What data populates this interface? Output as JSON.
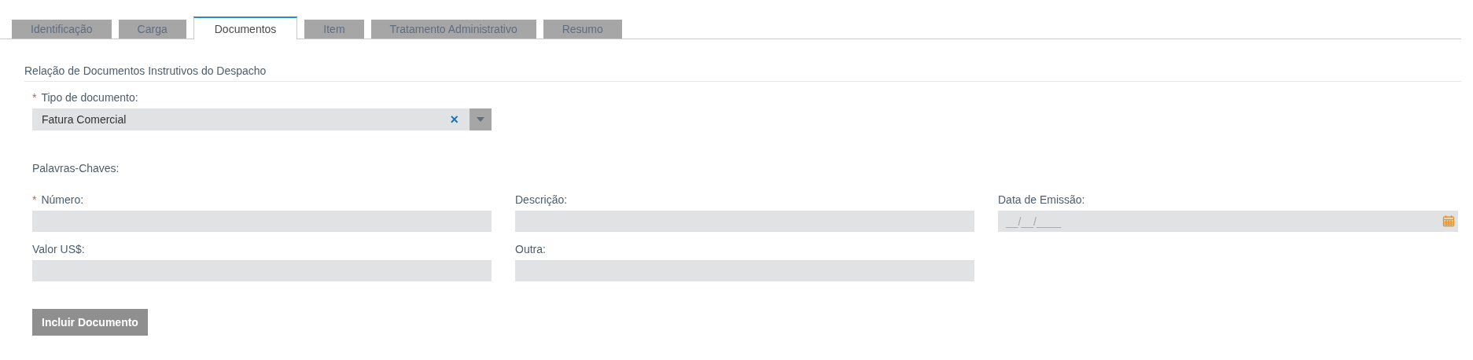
{
  "tabs": [
    {
      "label": "Identificação",
      "selected": false
    },
    {
      "label": "Carga",
      "selected": false
    },
    {
      "label": "Documentos",
      "selected": true
    },
    {
      "label": "Item",
      "selected": false
    },
    {
      "label": "Tratamento Administrativo",
      "selected": false
    },
    {
      "label": "Resumo",
      "selected": false
    }
  ],
  "section_title": "Relação de Documentos Instrutivos do Despacho",
  "document_type": {
    "label": "Tipo de documento:",
    "required": true,
    "value": "Fatura Comercial",
    "clear": "×"
  },
  "keywords_label": "Palavras-Chaves:",
  "fields": [
    {
      "kind": "text",
      "label": "Número:",
      "required": true
    },
    {
      "kind": "text",
      "label": "Descrição:",
      "required": false
    },
    {
      "kind": "date",
      "label": "Data de Emissão:",
      "required": false,
      "placeholder": "__/__/____"
    },
    {
      "kind": "text",
      "label": "Valor US$:",
      "required": false
    },
    {
      "kind": "text",
      "label": "Outra:",
      "required": false
    }
  ],
  "required_mark": "*",
  "submit_button": "Incluir Documento"
}
